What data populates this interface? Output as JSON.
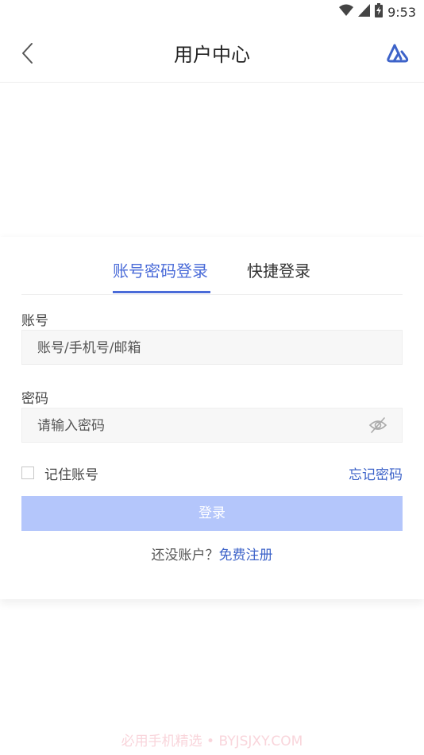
{
  "status_bar": {
    "time": "9:53"
  },
  "header": {
    "title": "用户中心"
  },
  "tabs": [
    {
      "label": "账号密码登录",
      "active": true
    },
    {
      "label": "快捷登录",
      "active": false
    }
  ],
  "form": {
    "account_label": "账号",
    "account_placeholder": "账号/手机号/邮箱",
    "password_label": "密码",
    "password_placeholder": "请输入密码",
    "remember_label": "记住账号",
    "forgot_link": "忘记密码",
    "login_button": "登录",
    "register_prompt": "还没账户？",
    "register_link": "免费注册"
  },
  "watermark": "必用手机精选 • BYJSJXY.COM",
  "colors": {
    "accent": "#4a6bd8",
    "button_disabled": "#b4c6fb",
    "link": "#3d63c9"
  },
  "icons": [
    "wifi-icon",
    "signal-icon",
    "battery-icon",
    "back-arrow-icon",
    "brand-logo-icon",
    "eye-hidden-icon",
    "checkbox-icon"
  ]
}
